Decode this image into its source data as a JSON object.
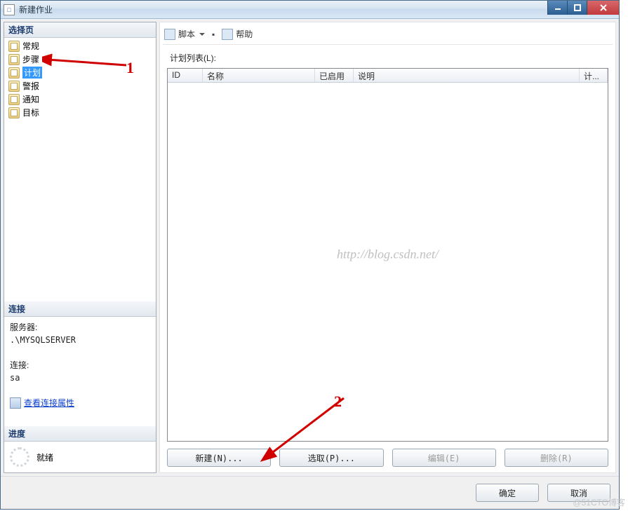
{
  "window": {
    "title": "新建作业"
  },
  "left": {
    "section_select": "选择页",
    "items": [
      "常规",
      "步骤",
      "计划",
      "警报",
      "通知",
      "目标"
    ],
    "selected_index": 2,
    "section_conn": "连接",
    "server_label": "服务器:",
    "server_value": ".\\MYSQLSERVER",
    "conn_label": "连接:",
    "conn_value": "sa",
    "view_props": "查看连接属性",
    "section_progress": "进度",
    "status": "就绪"
  },
  "toolbar": {
    "script": "脚本",
    "help": "帮助"
  },
  "main": {
    "list_label": "计划列表(L):",
    "columns": {
      "id": "ID",
      "name": "名称",
      "enabled": "已启用",
      "desc": "说明",
      "plan": "计..."
    },
    "watermark": "http://blog.csdn.net/",
    "buttons": {
      "new": "新建(N)...",
      "pick": "选取(P)...",
      "edit": "编辑(E)",
      "delete": "删除(R)"
    }
  },
  "footer": {
    "ok": "确定",
    "cancel": "取消"
  },
  "annotations": {
    "one": "1",
    "two": "2"
  },
  "credit": "@51CTO博客"
}
